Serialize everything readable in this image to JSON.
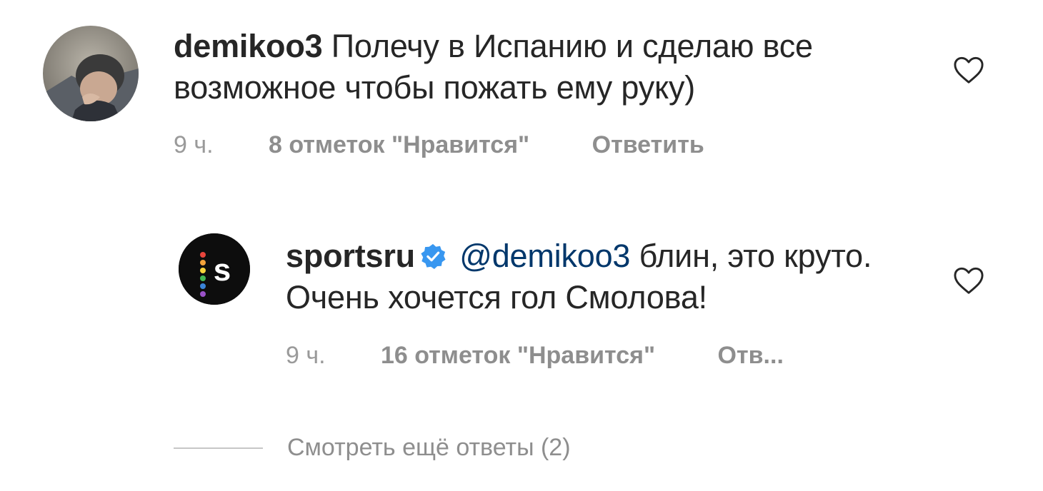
{
  "comments": [
    {
      "username": "demikoo3",
      "text": "Полечу в Испанию и сделаю все возможное чтобы пожать ему руку)",
      "time": "9 ч.",
      "likes": "8 отметок \"Нравится\"",
      "reply": "Ответить"
    },
    {
      "username": "sportsru",
      "verified": true,
      "mention": "@demikoo3",
      "text": "блин, это круто. Очень хочется гол Смолова!",
      "time": "9 ч.",
      "likes": "16 отметок \"Нравится\"",
      "reply": "Отв..."
    }
  ],
  "more_replies": "Смотреть ещё ответы (2)",
  "icons": {
    "like": "heart-outline-icon",
    "verified": "verified-badge-icon"
  },
  "colors": {
    "text": "#262626",
    "secondary": "#8e8e8e",
    "mention": "#00376b",
    "verified": "#3897f0",
    "logo_bg": "#0d0d0d"
  }
}
